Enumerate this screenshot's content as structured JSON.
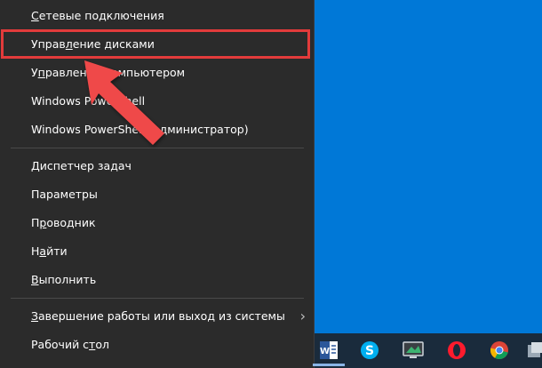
{
  "menu": {
    "items": [
      {
        "pre": "",
        "u": "С",
        "post": "етевые подключения"
      },
      {
        "pre": "Управ",
        "u": "л",
        "post": "ение дисками"
      },
      {
        "pre": "У",
        "u": "п",
        "post": "равление компьютером"
      },
      {
        "pre": "Windows PowerShell",
        "u": "",
        "post": ""
      },
      {
        "pre": "Windows PowerShell (",
        "u": "а",
        "post": "дминистратор)"
      },
      {
        "pre": "",
        "u": "Д",
        "post": "испетчер задач"
      },
      {
        "pre": "Параметры",
        "u": "",
        "post": ""
      },
      {
        "pre": "П",
        "u": "р",
        "post": "оводник"
      },
      {
        "pre": "Н",
        "u": "а",
        "post": "йти"
      },
      {
        "pre": "",
        "u": "В",
        "post": "ыполнить"
      },
      {
        "pre": "",
        "u": "З",
        "post": "авершение работы или выход из системы"
      },
      {
        "pre": "Рабочий с",
        "u": "т",
        "post": "ол"
      }
    ]
  },
  "taskbar": {
    "icons": [
      "word-icon",
      "skype-icon",
      "monitor-icon",
      "opera-icon",
      "chrome-icon",
      "app-icon"
    ]
  },
  "colors": {
    "desktop": "#0078d7",
    "menu_bg": "#2b2b2b",
    "highlight": "#e23b3b"
  }
}
